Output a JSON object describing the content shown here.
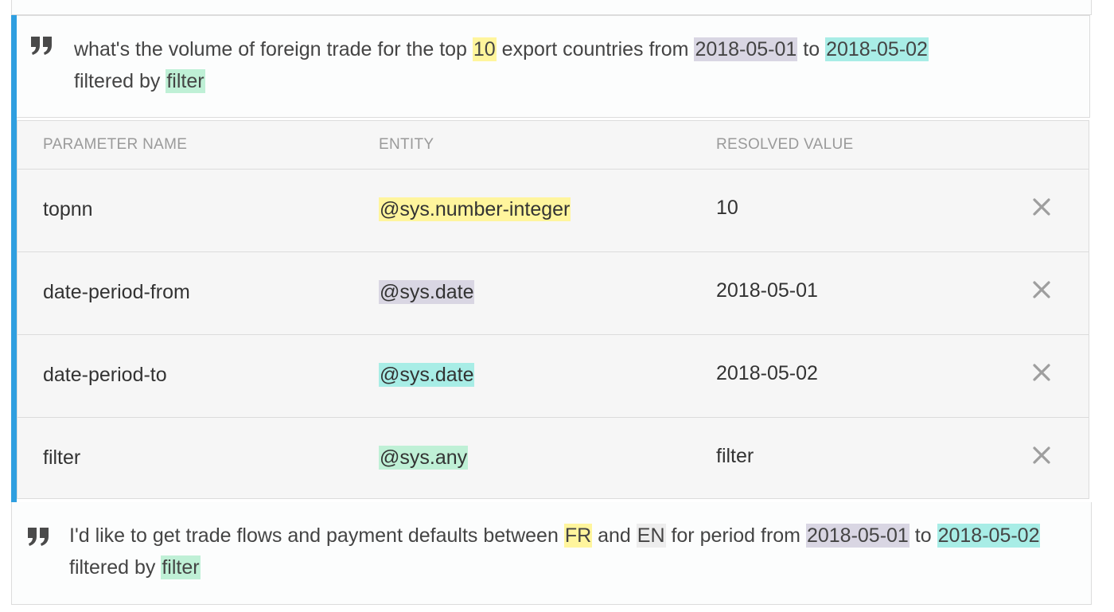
{
  "phrases": [
    {
      "segments": [
        {
          "text": "what's the volume of foreign trade for the top ",
          "hl": ""
        },
        {
          "text": "10",
          "hl": "yellow"
        },
        {
          "text": " export countries from ",
          "hl": ""
        },
        {
          "text": "2018-05-01",
          "hl": "gray"
        },
        {
          "text": " to ",
          "hl": ""
        },
        {
          "text": "2018-05-02",
          "hl": "cyan"
        },
        {
          "text": " filtered by ",
          "hl": ""
        },
        {
          "text": "filter",
          "hl": "green"
        }
      ]
    },
    {
      "segments": [
        {
          "text": "I'd like to get trade flows and payment defaults between ",
          "hl": ""
        },
        {
          "text": "FR",
          "hl": "yellow"
        },
        {
          "text": " and ",
          "hl": ""
        },
        {
          "text": "EN",
          "hl": "light"
        },
        {
          "text": " for period from ",
          "hl": ""
        },
        {
          "text": "2018-05-01",
          "hl": "gray"
        },
        {
          "text": " to ",
          "hl": ""
        },
        {
          "text": "2018-05-02",
          "hl": "cyan"
        },
        {
          "text": " filtered by ",
          "hl": ""
        },
        {
          "text": "filter",
          "hl": "green"
        }
      ]
    }
  ],
  "table": {
    "headers": {
      "name": "PARAMETER NAME",
      "entity": "ENTITY",
      "value": "RESOLVED VALUE"
    },
    "rows": [
      {
        "name": "topnn",
        "entity": "@sys.number-integer",
        "entity_hl": "yellow",
        "value": "10"
      },
      {
        "name": "date-period-from",
        "entity": "@sys.date",
        "entity_hl": "gray",
        "value": "2018-05-01"
      },
      {
        "name": "date-period-to",
        "entity": "@sys.date",
        "entity_hl": "cyan",
        "value": "2018-05-02"
      },
      {
        "name": "filter",
        "entity": "@sys.any",
        "entity_hl": "green",
        "value": "filter"
      }
    ]
  },
  "icons": {
    "quote": "quote-icon",
    "delete": "close-icon"
  },
  "colors": {
    "accent": "#2f9fe0",
    "yellow": "#fff59d",
    "gray": "#d9d6e3",
    "cyan": "#a8ede6",
    "green": "#bff0d6",
    "light": "#ededed"
  }
}
